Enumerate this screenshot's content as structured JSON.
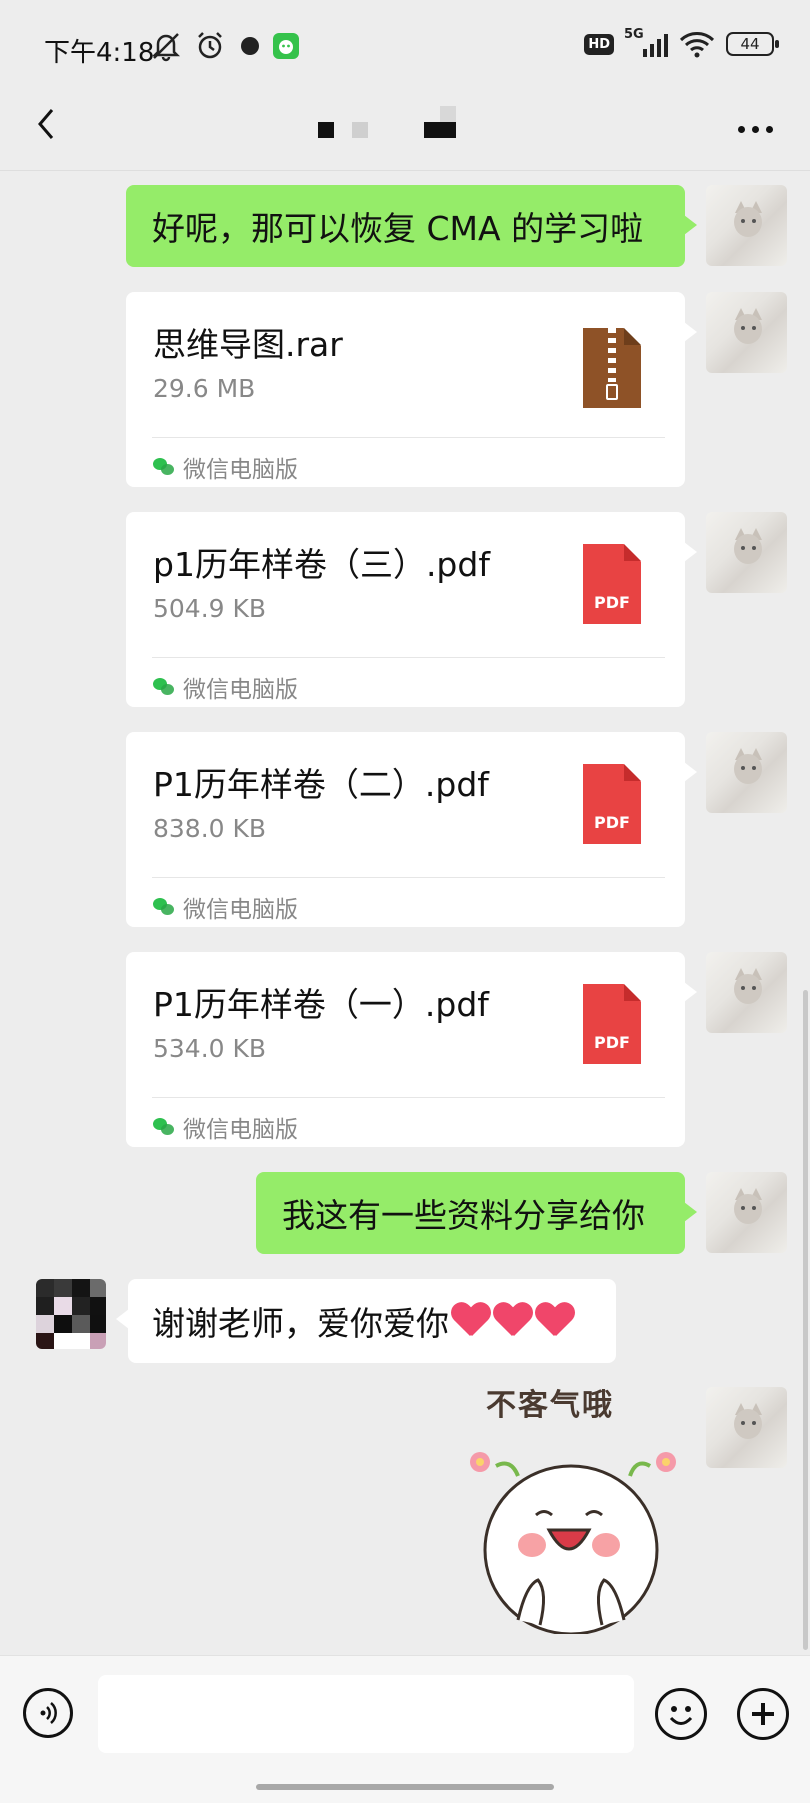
{
  "status_bar": {
    "time": "下午4:18",
    "hd_label": "HD",
    "network_label": "5G",
    "battery_level": "44"
  },
  "nav": {
    "title": "",
    "back_icon": "chevron-left-icon",
    "more_icon": "more-dots-icon"
  },
  "messages": [
    {
      "type": "text",
      "from": "me",
      "text": "好呢，那可以恢复 CMA 的学习啦"
    },
    {
      "type": "file",
      "from": "me",
      "name": "思维导图.rar",
      "size": "29.6 MB",
      "file_type": "zip",
      "source": "微信电脑版"
    },
    {
      "type": "file",
      "from": "me",
      "name": "p1历年样卷（三）.pdf",
      "size": "504.9 KB",
      "file_type": "pdf",
      "file_icon_label": "PDF",
      "source": "微信电脑版"
    },
    {
      "type": "file",
      "from": "me",
      "name": "P1历年样卷（二）.pdf",
      "size": "838.0 KB",
      "file_type": "pdf",
      "file_icon_label": "PDF",
      "source": "微信电脑版"
    },
    {
      "type": "file",
      "from": "me",
      "name": "P1历年样卷（一）.pdf",
      "size": "534.0 KB",
      "file_type": "pdf",
      "file_icon_label": "PDF",
      "source": "微信电脑版"
    },
    {
      "type": "text",
      "from": "me",
      "text": "我这有一些资料分享给你"
    },
    {
      "type": "text",
      "from": "other",
      "text": "谢谢老师，爱你爱你",
      "emoji_count": 3
    },
    {
      "type": "sticker",
      "from": "me",
      "caption": "不客气哦"
    }
  ],
  "input_bar": {
    "placeholder": "",
    "voice_icon": "voice-icon",
    "emoji_icon": "emoji-icon",
    "plus_icon": "plus-icon"
  },
  "colors": {
    "my_bubble": "#95ec69",
    "other_bubble": "#ffffff",
    "background": "#ededed",
    "pdf": "#e84343",
    "zip": "#8e5227"
  }
}
